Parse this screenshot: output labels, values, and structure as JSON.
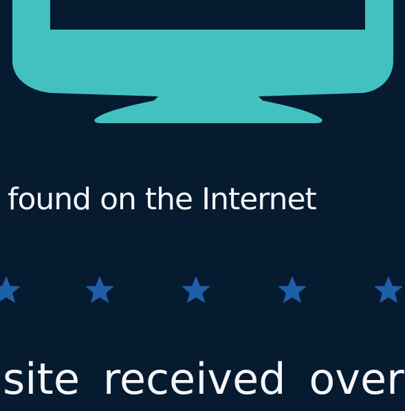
{
  "colors": {
    "background": "#061a30",
    "monitor": "#42c1c0",
    "star": "#1f5ea8",
    "text": "#f4f6f8"
  },
  "icons": {
    "monitor": "monitor-icon",
    "rating_star": "star-icon"
  },
  "tagline": "found on the Internet",
  "rating": {
    "visible_stars": 5
  },
  "bottom_text": "site received over"
}
